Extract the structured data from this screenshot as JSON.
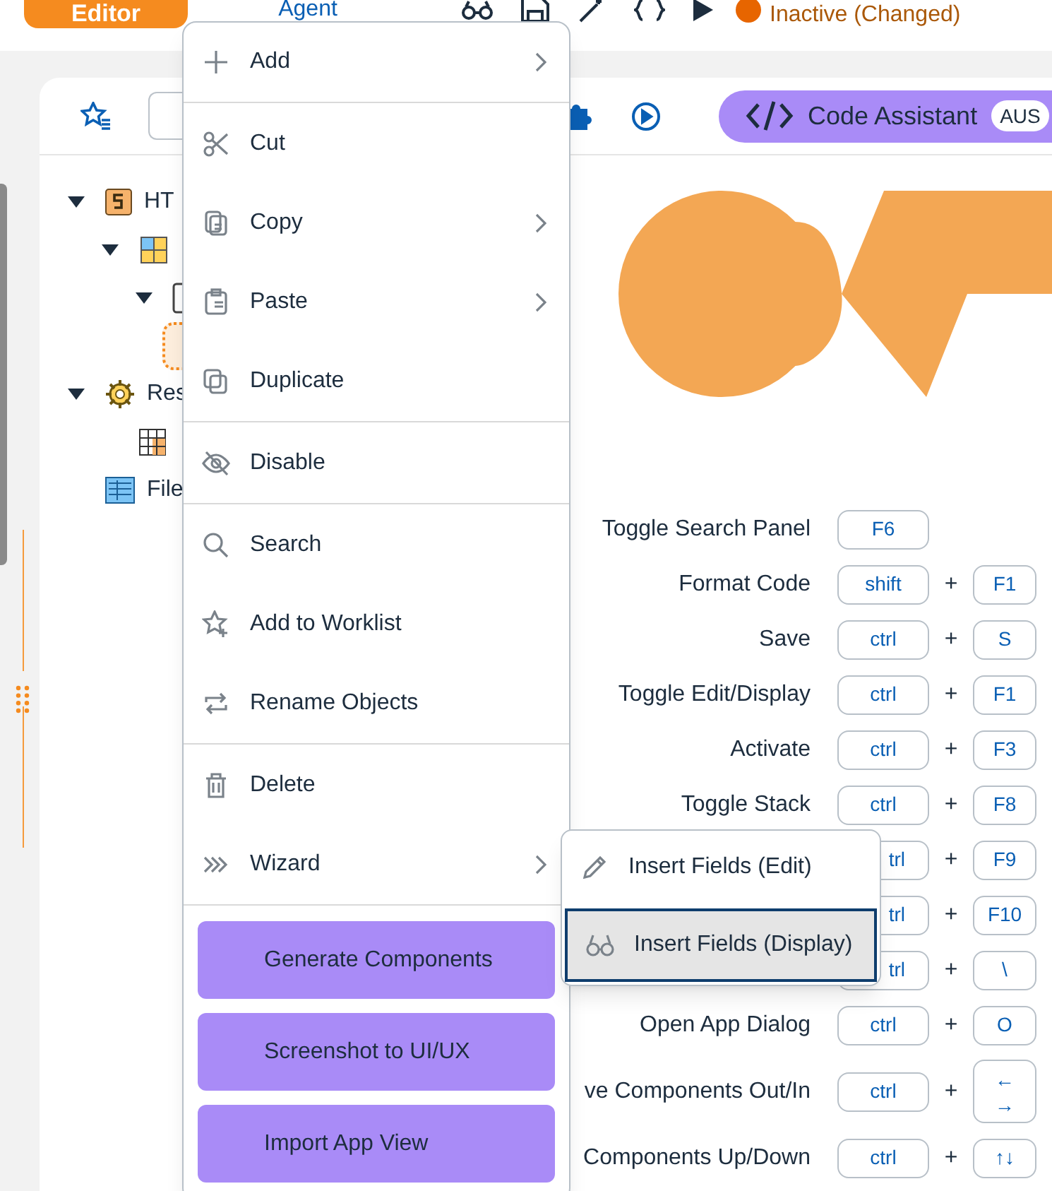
{
  "top_bar": {
    "tabs": [
      {
        "label": "Editor",
        "selected": true
      },
      {
        "label": "Agent",
        "selected": false
      }
    ],
    "status": "Inactive (Changed)"
  },
  "toolbar": {
    "code_assistant": {
      "label": "Code Assistant",
      "badge": "AUS"
    }
  },
  "tree": [
    {
      "label": "HT",
      "kind": "html",
      "expanded": true,
      "selected": false,
      "children": [
        {
          "kind": "app",
          "expanded": true,
          "selected": false,
          "children": [
            {
              "kind": "page",
              "expanded": true,
              "selected": false,
              "children": [
                {
                  "selected": true
                }
              ]
            }
          ]
        }
      ]
    },
    {
      "label": "Res",
      "kind": "resources",
      "expanded": true,
      "selected": false,
      "children": [
        {
          "kind": "table",
          "selected": false
        }
      ]
    },
    {
      "label": "File",
      "kind": "files",
      "selected": false
    }
  ],
  "shortcuts": [
    {
      "label": "Toggle Search Panel",
      "keys": [
        "F6"
      ]
    },
    {
      "label": "Format Code",
      "keys": [
        "shift",
        "F1"
      ],
      "joiner": "+"
    },
    {
      "label": "Save",
      "keys": [
        "ctrl",
        "S"
      ],
      "joiner": "+"
    },
    {
      "label": "Toggle Edit/Display",
      "keys": [
        "ctrl",
        "F1"
      ],
      "joiner": "+"
    },
    {
      "label": "Activate",
      "keys": [
        "ctrl",
        "F3"
      ],
      "joiner": "+"
    },
    {
      "label": "Toggle Stack",
      "keys": [
        "ctrl",
        "F8"
      ],
      "joiner": "+"
    },
    {
      "keys": [
        "trl",
        "F9"
      ],
      "joiner": "+"
    },
    {
      "keys": [
        "trl",
        "F10"
      ],
      "joiner": "+"
    },
    {
      "keys": [
        "trl",
        "\\"
      ],
      "joiner": "+"
    },
    {
      "label": "Open App Dialog",
      "keys": [
        "ctrl",
        "O"
      ],
      "joiner": "+"
    },
    {
      "label": "ve Components Out/In",
      "keys": [
        "ctrl",
        "←\n→"
      ],
      "joiner": "+"
    },
    {
      "label": "Components Up/Down",
      "keys": [
        "ctrl",
        "↑↓"
      ],
      "joiner": "+"
    }
  ],
  "context_menu": [
    {
      "kind": "item",
      "label": "Add",
      "submenu": true
    },
    {
      "kind": "separator"
    },
    {
      "kind": "item",
      "label": "Cut",
      "submenu": false
    },
    {
      "kind": "item",
      "label": "Copy",
      "submenu": true
    },
    {
      "kind": "item",
      "label": "Paste",
      "submenu": true
    },
    {
      "kind": "item",
      "label": "Duplicate",
      "submenu": false
    },
    {
      "kind": "separator"
    },
    {
      "kind": "item",
      "label": "Disable",
      "submenu": false
    },
    {
      "kind": "separator"
    },
    {
      "kind": "item",
      "label": "Search",
      "submenu": false
    },
    {
      "kind": "item",
      "label": "Add to Worklist",
      "submenu": false
    },
    {
      "kind": "item",
      "label": "Rename Objects",
      "submenu": false
    },
    {
      "kind": "separator"
    },
    {
      "kind": "item",
      "label": "Delete",
      "submenu": false
    },
    {
      "kind": "item",
      "label": "Wizard",
      "submenu": true
    },
    {
      "kind": "separator"
    },
    {
      "kind": "action",
      "label": "Generate Components"
    },
    {
      "kind": "action",
      "label": "Screenshot to UI/UX"
    },
    {
      "kind": "action",
      "label": "Import App View"
    }
  ],
  "submenu": [
    {
      "label": "Insert Fields (Edit)",
      "selected": false
    },
    {
      "label": "Insert Fields (Display)",
      "selected": true
    }
  ]
}
